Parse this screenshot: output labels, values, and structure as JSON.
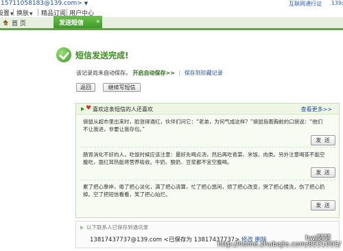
{
  "top": {
    "address": ":15711058183@139.com>",
    "license": "互联网通行证",
    "number": "139@"
  },
  "menu": {
    "items": [
      "设置",
      "换肤",
      "精品订阅",
      "用户中心"
    ]
  },
  "tabs": {
    "home": "首 页",
    "send": "发送短信",
    "close": "x"
  },
  "status": {
    "title": "短信发送完成!",
    "notice": "该记录尚未自动保存。",
    "auto_save": "开启自动保存>>",
    "save_link": "保存到珍藏记录",
    "back": "返回",
    "continue": "继续写短信"
  },
  "panel": {
    "heading": "喜欢这条短信的人还喜欢",
    "more": "查看更多>>",
    "messages": [
      {
        "text": "袋鼠从超市里出来时，脸涨得通红，伙伴们问它：“老弟，为何气成这样？”袋鼠指着胸前的口袋说：“他们不让我进，非要让我存包。”",
        "send": "发 送"
      },
      {
        "text": "肠胃消化不好的人，吃饭时候应该注意：最好先喝点汤，然后再吃青菜、米饭、肉类。另外注意喝茶不能空腹吃，面红耳热能将营养吸收。牛奶、酸奶、豆浆都不宜空腹喝。",
        "send": "发 送"
      },
      {
        "text": "累了把心靠岸，倦了把心淡化，满了把心清算，忙了把心悠闲，烦了把心改变，哭了把心揉洗，伤了把心扔掉。空了把短信看看，笑了把心灿烂。",
        "send": "发 送"
      }
    ]
  },
  "contacts": {
    "label": "以下联系人已保存到通讯录",
    "entry": "13817437737@139.com <已保存为 13817437737>",
    "edit": "修改",
    "delete": "删除"
  },
  "watermark": {
    "name": "hwj瑟瑟",
    "url": "http://home.zhubajie.com/8531005/"
  }
}
